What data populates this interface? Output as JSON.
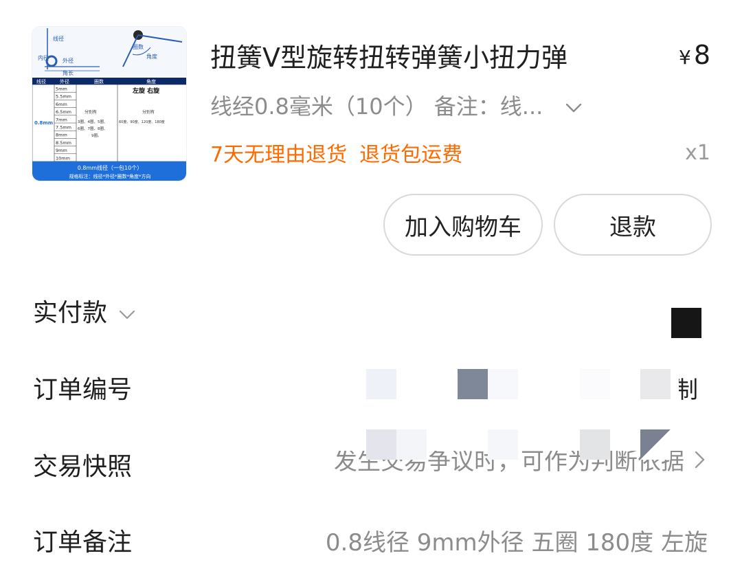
{
  "product": {
    "title": "扭簧V型旋转扭转弹簧小扭力弹",
    "price_symbol": "¥",
    "price": "8",
    "spec": "线经0.8毫米（10个） 备注：线...",
    "tags": [
      "7天无理由退货",
      "退货包运费"
    ],
    "quantity": "x1",
    "thumbnail": {
      "labels": {
        "wire_dia": "线径",
        "inner_dia": "内径",
        "outer_dia": "外径",
        "coils": "圈数",
        "angle": "角度",
        "arm_len": "角长",
        "col_wire": "线径",
        "col_outer": "外径",
        "col_coils": "圈数",
        "col_angle": "角度",
        "direction": "左旋 右旋",
        "wire_value": "0.8mm",
        "sizes": [
          "5mm",
          "5.5mm",
          "6mm",
          "6.5mm",
          "7mm",
          "7.5mm",
          "8mm",
          "8.5mm",
          "9mm",
          "10mm"
        ],
        "coil_note": "分别有",
        "coil_options_1": "3圈、4圈、5圈、",
        "coil_options_2": "6圈、7圈、8圈、",
        "coil_options_3": "9圈。",
        "angle_note": "分别有",
        "angle_options": "60度、90度、120度、180度",
        "footer_1": "0.8mm线径（一包10个）",
        "footer_2": "规格标注：线径*外径*圈数*角度*方向"
      }
    }
  },
  "actions": {
    "add_to_cart": "加入购物车",
    "refund": "退款"
  },
  "rows": {
    "paid": {
      "label": "实付款"
    },
    "order_no": {
      "label": "订单编号",
      "value_tail": "制"
    },
    "snapshot": {
      "label": "交易快照",
      "value": "发生交易争议时，可作为判断依据"
    },
    "note": {
      "label": "订单备注",
      "value": "0.8线径 9mm外径 五圈 180度 左旋"
    }
  },
  "colors": {
    "tag_orange": "#ff6a00",
    "muted_text": "#8c8c8c",
    "thumb_blue": "#1e6fd9"
  },
  "icons": {
    "spec_expand": "chevron-down-icon",
    "paid_expand": "chevron-down-icon",
    "snapshot_go": "chevron-right-icon"
  }
}
